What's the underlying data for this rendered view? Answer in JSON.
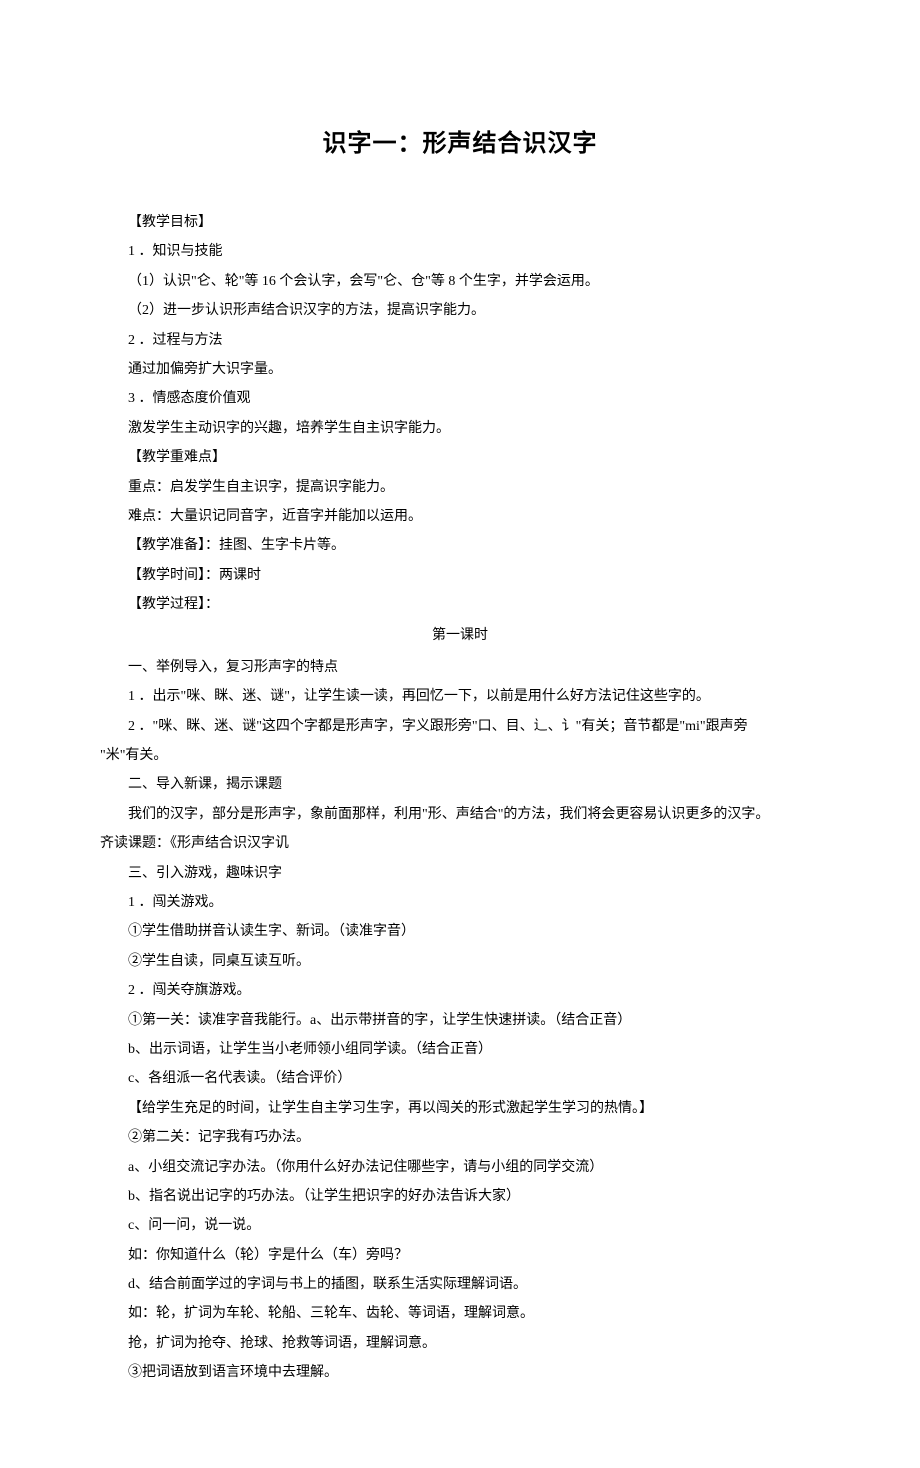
{
  "title": "识字一：形声结合识汉字",
  "lines": {
    "l1": "【教学目标】",
    "l2": "1 ．知识与技能",
    "l3": "（1）认识\"仑、轮\"等 16 个会认字，会写\"仑、仓\"等 8 个生字，并学会运用。",
    "l4": "（2）进一步认识形声结合识汉字的方法，提高识字能力。",
    "l5": "2 ．过程与方法",
    "l6": "通过加偏旁扩大识字量。",
    "l7": "3 ．情感态度价值观",
    "l8": "激发学生主动识字的兴趣，培养学生自主识字能力。",
    "l9": "【教学重难点】",
    "l10": "重点：启发学生自主识字，提高识字能力。",
    "l11": "难点：大量识记同音字，近音字并能加以运用。",
    "l12": "【教学准备】：挂图、生字卡片等。",
    "l13": "【教学时间】：两课时",
    "l14": "【教学过程】：",
    "sub1": "第一课时",
    "l15": "一、举例导入，复习形声字的特点",
    "l16": "1 ．出示\"咪、眯、迷、谜\"，让学生读一读，再回忆一下，以前是用什么好方法记住这些字的。",
    "l17a": "2 ．\"咪、眯、迷、谜\"这四个字都是形声字，字义跟形旁\"口、目、辶、讠\"有关；音节都是\"mi\"跟声旁",
    "l17b": "\"米\"有关。",
    "l18": "二、导入新课，揭示课题",
    "l19a": "我们的汉字，部分是形声字，象前面那样，利用\"形、声结合\"的方法，我们将会更容易认识更多的汉字。",
    "l19b": "齐读课题：《形声结合识汉字讥",
    "l20": "三、引入游戏，趣味识字",
    "l21": "1 ．闯关游戏。",
    "l22": "①学生借助拼音认读生字、新词。（读准字音）",
    "l23": "②学生自读，同桌互读互听。",
    "l24": "2 ．闯关夺旗游戏。",
    "l25": "①第一关：读准字音我能行。a、出示带拼音的字，让学生快速拼读。（结合正音）",
    "l26": "b、出示词语，让学生当小老师领小组同学读。（结合正音）",
    "l27": "c、各组派一名代表读。（结合评价）",
    "l28": "【给学生充足的时间，让学生自主学习生字，再以闯关的形式激起学生学习的热情。】",
    "l29": "②第二关：记字我有巧办法。",
    "l30": "a、小组交流记字办法。（你用什么好办法记住哪些字，请与小组的同学交流）",
    "l31": "b、指名说出记字的巧办法。（让学生把识字的好办法告诉大家）",
    "l32": "c、问一问，说一说。",
    "l33": "如：你知道什么（轮）字是什么（车）旁吗？",
    "l34": "d、结合前面学过的字词与书上的插图，联系生活实际理解词语。",
    "l35": "如：轮，扩词为车轮、轮船、三轮车、齿轮、等词语，理解词意。",
    "l36": "抢，扩词为抢夺、抢球、抢救等词语，理解词意。",
    "l37": "③把词语放到语言环境中去理解。"
  }
}
